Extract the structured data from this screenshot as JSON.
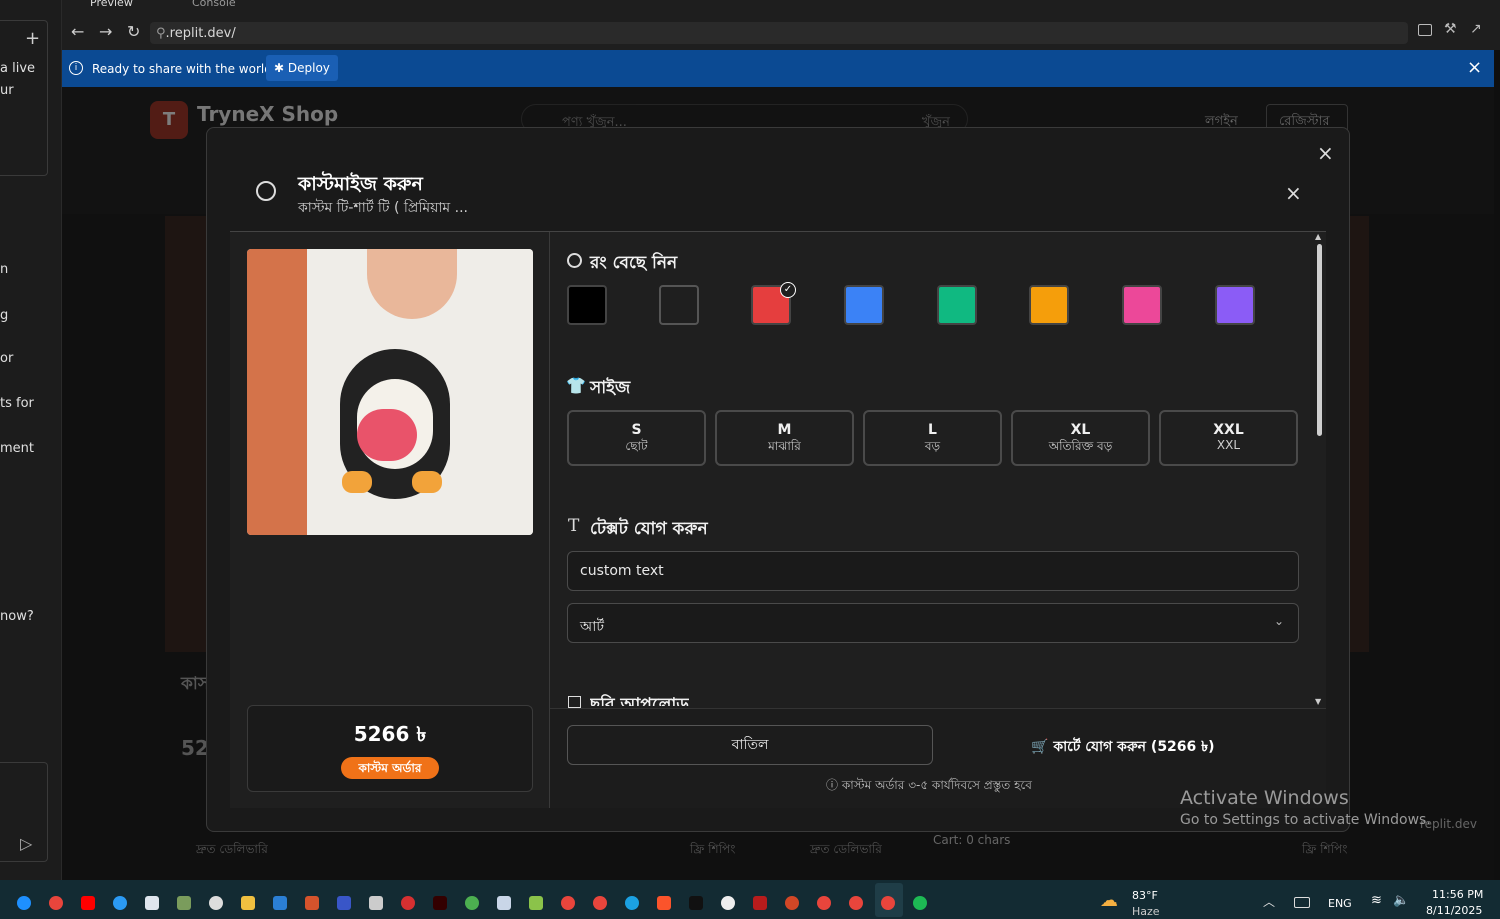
{
  "left_panel": {
    "lines": [
      "a live",
      "ur",
      "n",
      "g",
      "or",
      "ts for",
      "ment",
      "now?"
    ],
    "plus": "+",
    "send": "▷"
  },
  "browser": {
    "tab_preview": "Preview",
    "tab_console": "Console",
    "url": ".replit.dev/",
    "back": "←",
    "forward": "→",
    "reload": "↻"
  },
  "banner": {
    "text": "Ready to share with the world?",
    "deploy": "Deploy",
    "close": "×"
  },
  "shop": {
    "logo_letter": "T",
    "name": "TryneX Shop",
    "search_placeholder": "পণ্য খুঁজুন...",
    "search_button": "খুঁজুন",
    "login": "লগইন",
    "register": "রেজিস্টার",
    "bottom_links": [
      "দ্রুত ডেলিভারি",
      "ফ্রি শিপিং",
      "দ্রুত ডেলিভারি",
      "ফ্রি শিপিং"
    ],
    "cart_chars": "Cart: 0 chars",
    "replit_url": "replit.dev",
    "partial_title": "কাস",
    "partial_price": "52"
  },
  "modal": {
    "outer_close": "×",
    "close": "×",
    "title": "কাস্টমাইজ করুন",
    "subtitle": "কাস্টম টি-শার্ট টি ( প্রিমিয়াম ...",
    "price": "5266 ৳",
    "badge": "কাস্টম অর্ডার",
    "color_heading": "রং বেছে নিন",
    "colors": [
      "#000000",
      "#1f1f1f",
      "#e53e3e",
      "#3b82f6",
      "#10b981",
      "#f59e0b",
      "#ec4899",
      "#8b5cf6"
    ],
    "size_heading": "সাইজ",
    "sizes": [
      {
        "code": "S",
        "label": "ছোট"
      },
      {
        "code": "M",
        "label": "মাঝারি"
      },
      {
        "code": "L",
        "label": "বড়"
      },
      {
        "code": "XL",
        "label": "অতিরিক্ত বড়"
      },
      {
        "code": "XXL",
        "label": "XXL"
      }
    ],
    "text_heading": "টেক্সট যোগ করুন",
    "text_value": "custom text",
    "font_value": "আর্ট",
    "upload_heading": "ছবি আপলোড",
    "cancel": "বাতিল",
    "add_to_cart": "কার্টে যোগ করুন (5266 ৳)",
    "note": "কাস্টম অর্ডার ৩-৫ কার্যদিবসে প্রস্তুত হবে"
  },
  "windows": {
    "activate_title": "Activate Windows",
    "activate_sub": "Go to Settings to activate Windows."
  },
  "taskbar": {
    "weather_temp": "83°F",
    "weather_desc": "Haze",
    "lang": "ENG",
    "time": "11:56 PM",
    "date": "8/11/2025"
  }
}
